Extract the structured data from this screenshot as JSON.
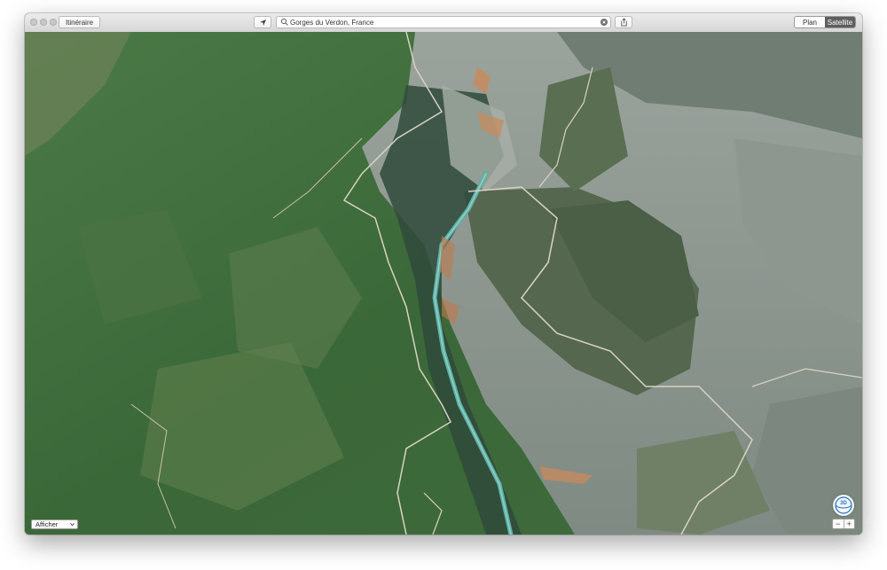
{
  "toolbar": {
    "directions_label": "Itinéraire",
    "search_value": "Gorges du Verdon, France",
    "map_mode": {
      "plan_label": "Plan",
      "satellite_label": "Satellite",
      "selected": "Satellite"
    }
  },
  "map": {
    "view_menu_label": "Afficher",
    "compass_label": "3D",
    "zoom_out_label": "−",
    "zoom_in_label": "+"
  },
  "colors": {
    "forest": "#3d6a3c",
    "rock": "#8a9590",
    "river": "#5fb0a6",
    "road": "#d9d2c3",
    "selected_segment": "#5f5f5f"
  },
  "icons": [
    "location-arrow-icon",
    "search-icon",
    "clear-icon",
    "share-icon",
    "chevron-down-icon"
  ]
}
